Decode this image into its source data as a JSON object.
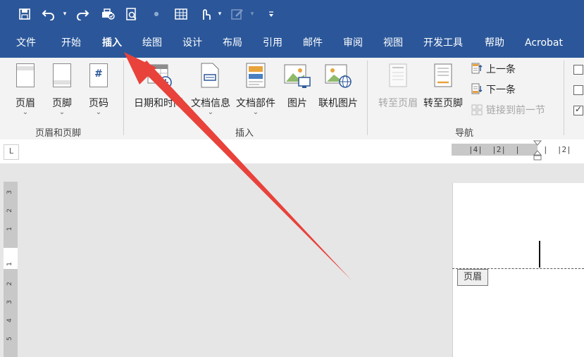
{
  "quick_access_icons": [
    "save-icon",
    "undo-icon",
    "redo-icon",
    "print-preview-icon",
    "search-document-icon",
    "table-icon",
    "touch-icon",
    "pen-icon",
    "customize-icon"
  ],
  "tabs": [
    "文件",
    "开始",
    "插入",
    "绘图",
    "设计",
    "布局",
    "引用",
    "邮件",
    "审阅",
    "视图",
    "开发工具",
    "帮助",
    "Acrobat"
  ],
  "active_tab": "插入",
  "ribbon": {
    "header_footer_group": {
      "header": "页眉",
      "footer": "页脚",
      "page_number": "页码",
      "page_number_glyph": "#",
      "label": "页眉和页脚"
    },
    "insert_group": {
      "date_time": "日期和时间",
      "doc_info": "文档信息",
      "doc_parts": "文档部件",
      "picture": "图片",
      "online_picture": "联机图片",
      "label": "插入"
    },
    "navigation_group": {
      "goto_header": "转至页眉",
      "goto_footer": "转至页脚",
      "previous": "上一条",
      "next": "下一条",
      "link_previous": "链接到前一节",
      "label": "导航"
    },
    "checkbox_check": "✓"
  },
  "ruler": {
    "corner_glyph": "L",
    "horizontal_text": "|4|  |2|  |     |  |2|",
    "vertical_numbers": [
      "3",
      "2",
      "1",
      "1",
      "2",
      "3",
      "4",
      "5"
    ]
  },
  "document": {
    "header_tag": "页眉"
  },
  "colors": {
    "ribbon_blue": "#2b579a",
    "arrow_red": "#e8423b"
  }
}
